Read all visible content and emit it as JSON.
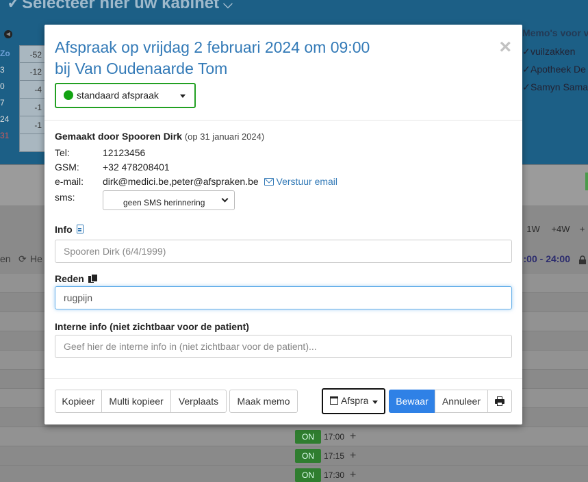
{
  "background": {
    "header_title": "Selecteer hier uw kabinet",
    "left_col": [
      "Zo",
      "3",
      "0",
      "7",
      "24",
      "31"
    ],
    "grid_values": [
      "-52",
      "-12",
      "-4",
      "-1",
      "-1",
      ""
    ],
    "memo_title": "Memo's voor va",
    "memo_items": [
      "vuilzakken",
      "Apotheek De",
      "Samyn Sama"
    ],
    "week_buttons": [
      "1W",
      "+4W",
      "+"
    ],
    "status_left": "en",
    "status_mid": "He",
    "status_right": ":00 - 24:00",
    "slots": [
      {
        "badge": "ON",
        "time": "17:00"
      },
      {
        "badge": "ON",
        "time": "17:15"
      },
      {
        "badge": "ON",
        "time": "17:30"
      }
    ]
  },
  "modal": {
    "title_line1": "Afspraak op vrijdag 2 februari 2024 om 09:00",
    "title_line2": "bij Van Oudenaarde Tom",
    "close_glyph": "×",
    "type_select": {
      "value": "standaard afspraak",
      "color": "#13a313"
    },
    "created": {
      "label": "Gemaakt door Spooren Dirk",
      "date": "(op 31 januari 2024)"
    },
    "contact": {
      "tel_label": "Tel:",
      "tel": "12123456",
      "gsm_label": "GSM:",
      "gsm": "+32 478208401",
      "email_label": "e-mail:",
      "email": "dirk@medici.be,peter@afspraken.be",
      "email_action": "Verstuur email",
      "sms_label": "sms:",
      "sms_value": "geen SMS herinnering"
    },
    "info": {
      "label": "Info",
      "placeholder": "Spooren Dirk (6/4/1999)",
      "value": ""
    },
    "reden": {
      "label": "Reden",
      "value": "rugpijn"
    },
    "interne": {
      "label": "Interne info (niet zichtbaar voor de patient)",
      "placeholder": "Geef hier de interne info in (niet zichtbaar voor de patient)..."
    },
    "footer": {
      "copy": "Kopieer",
      "multi_copy": "Multi kopieer",
      "move": "Verplaats",
      "memo": "Maak memo",
      "calendar": "Afspraak",
      "save": "Bewaar",
      "cancel": "Annuleer"
    }
  }
}
